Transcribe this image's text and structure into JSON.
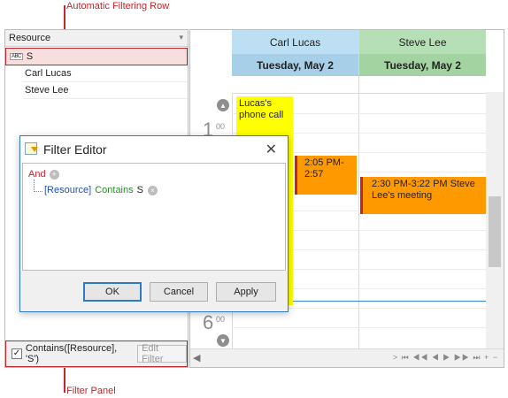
{
  "callouts": {
    "top": "Automatic Filtering Row",
    "bottom": "Filter Panel"
  },
  "resources_pane": {
    "header": "Resource",
    "filter_value": "S",
    "filter_icon_text": "ABC",
    "items": [
      "Carl Lucas",
      "Steve Lee"
    ],
    "filter_panel": {
      "checked": true,
      "expression": "Contains([Resource], 'S')",
      "edit_button": "Edit Filter"
    }
  },
  "scheduler": {
    "resources": [
      {
        "name": "Carl Lucas",
        "color": "#bddff4"
      },
      {
        "name": "Steve Lee",
        "color": "#b7dfb6"
      }
    ],
    "dates": [
      "Tuesday, May 2",
      "Tuesday, May 2"
    ],
    "times": [
      {
        "hour": "1",
        "minutes": "00"
      },
      {
        "hour": "6",
        "minutes": "00"
      }
    ],
    "appointments": [
      {
        "text": "Lucas's phone call",
        "color": "#ffff00"
      },
      {
        "text": "2:05 PM-2:57",
        "color": "#ff9900"
      },
      {
        "text": "2:30 PM-3:22 PM Steve Lee's meeting",
        "color": "#ff9900"
      }
    ],
    "nav_symbols": "> ⏮ ◀◀ ◀ ▶ ▶▶ ⏭ + −"
  },
  "dialog": {
    "title": "Filter Editor",
    "group_operator": "And",
    "condition_field": "[Resource]",
    "condition_operator": "Contains",
    "condition_value": "S",
    "buttons": {
      "ok": "OK",
      "cancel": "Cancel",
      "apply": "Apply"
    }
  },
  "colors": {
    "accent_red": "#c0272d",
    "dialog_border": "#2e7ac4",
    "yellow_appt": "#ffff00",
    "orange_appt": "#ff9900"
  }
}
